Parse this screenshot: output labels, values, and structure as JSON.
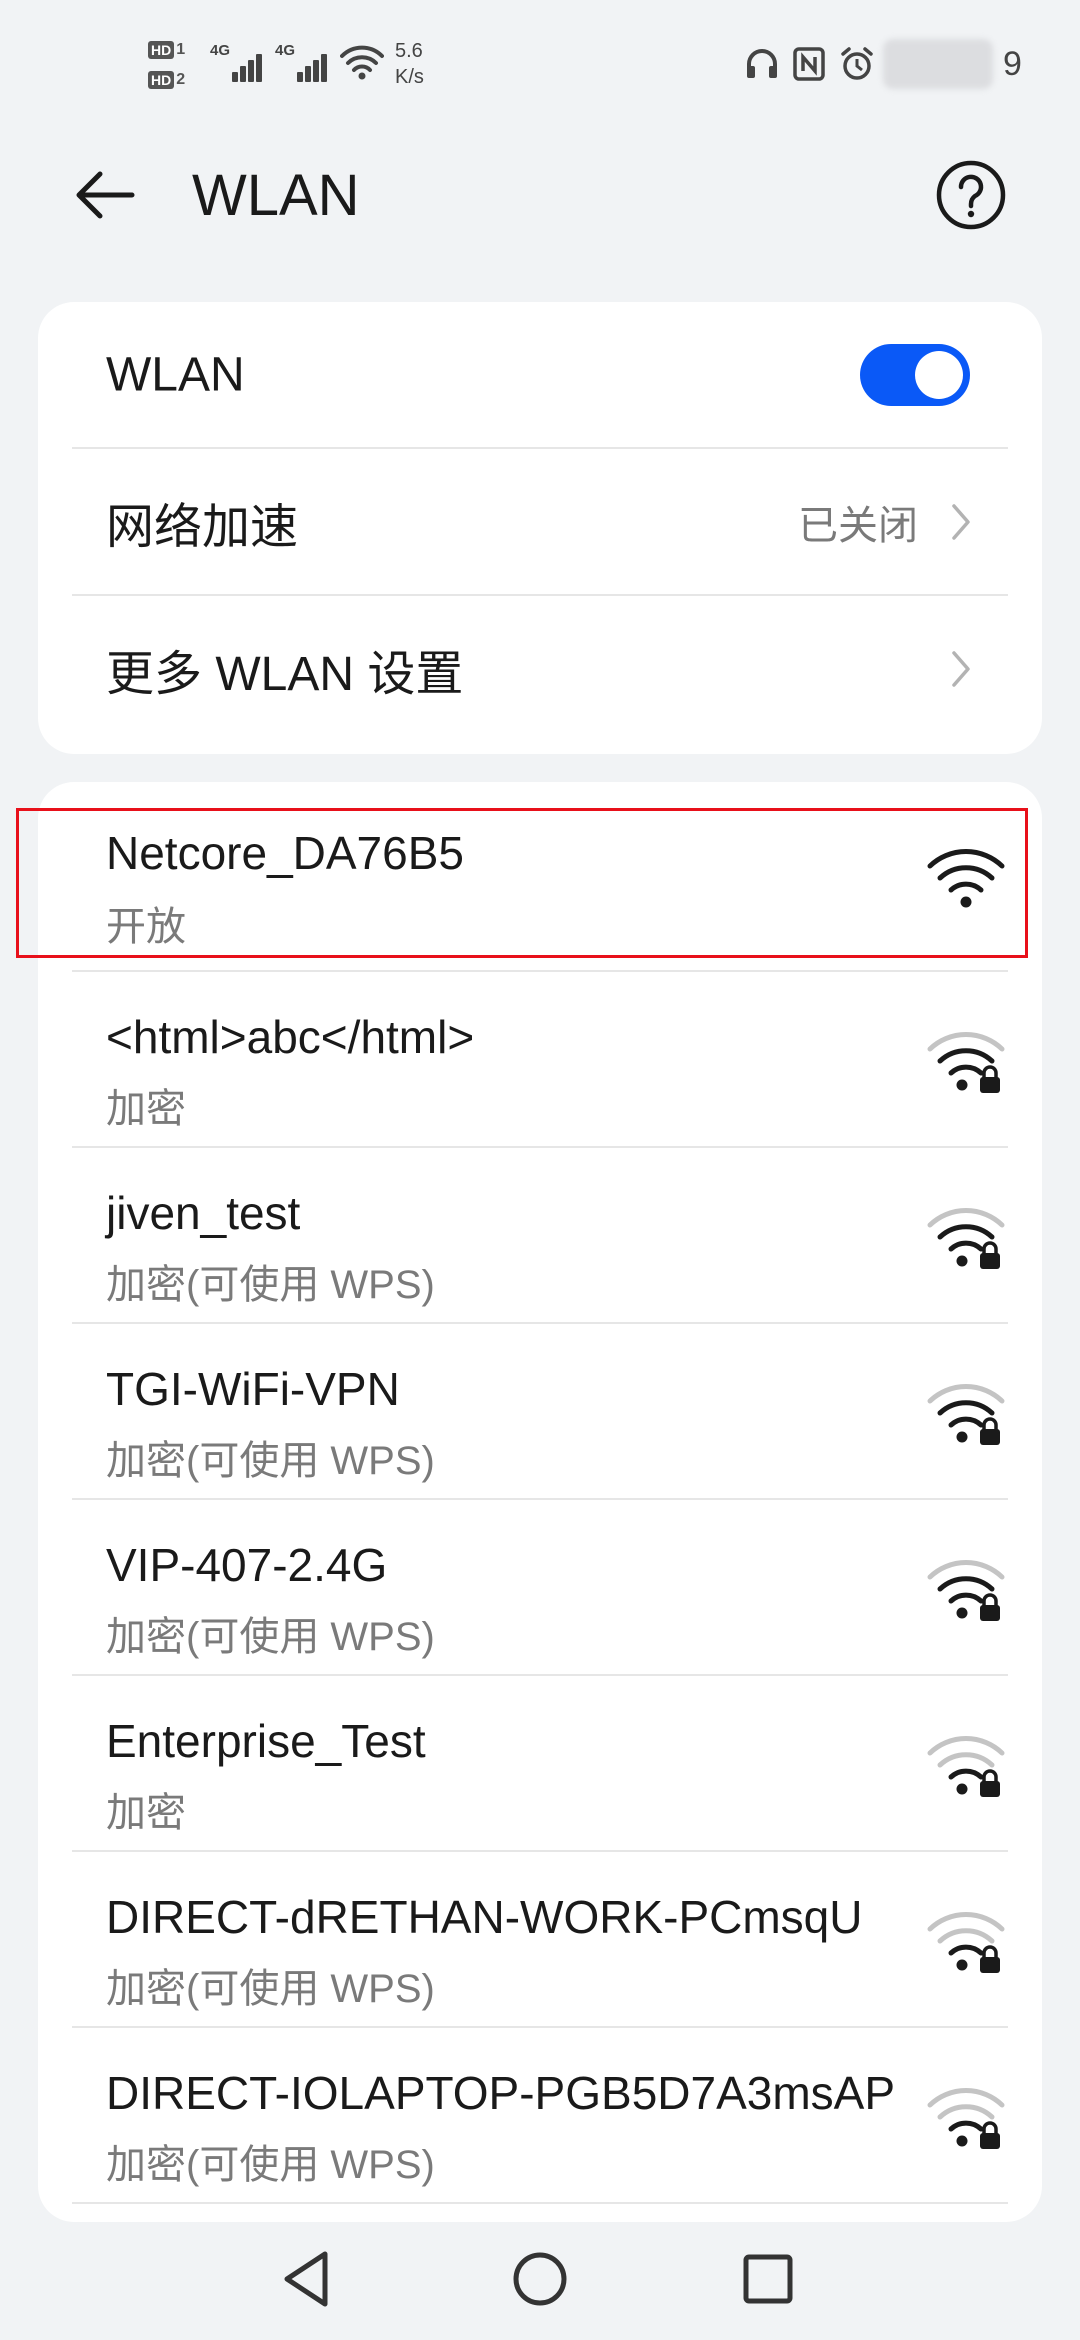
{
  "status_bar": {
    "hd1_label": "HD",
    "hd1_num": "1",
    "hd2_label": "HD",
    "hd2_num": "2",
    "sim1_label": "4G",
    "sim2_label": "4G",
    "speed_value": "5.6",
    "speed_unit": "K/s",
    "time_fragment": "9",
    "icons": [
      "headphones-icon",
      "nfc-icon",
      "alarm-icon",
      "battery-icon"
    ]
  },
  "header": {
    "title": "WLAN",
    "back_icon": "arrow-left-icon",
    "help_icon": "help-circle-icon"
  },
  "settings": {
    "wlan_label": "WLAN",
    "wlan_enabled": true,
    "accel_label": "网络加速",
    "accel_value": "已关闭",
    "more_label": "更多 WLAN 设置"
  },
  "networks": [
    {
      "name": "Netcore_DA76B5",
      "status": "开放",
      "secured": false,
      "signal": "full"
    },
    {
      "name": "<html>abc</html>",
      "status": "加密",
      "secured": true,
      "signal": "medium"
    },
    {
      "name": "jiven_test",
      "status": "加密(可使用 WPS)",
      "secured": true,
      "signal": "medium"
    },
    {
      "name": "TGI-WiFi-VPN",
      "status": "加密(可使用 WPS)",
      "secured": true,
      "signal": "medium"
    },
    {
      "name": "VIP-407-2.4G",
      "status": "加密(可使用 WPS)",
      "secured": true,
      "signal": "medium"
    },
    {
      "name": "Enterprise_Test",
      "status": "加密",
      "secured": true,
      "signal": "weak"
    },
    {
      "name": "DIRECT-dRETHAN-WORK-PCmsqU",
      "status": "加密(可使用 WPS)",
      "secured": true,
      "signal": "weak"
    },
    {
      "name": "DIRECT-IOLAPTOP-PGB5D7A3msAP",
      "status": "加密(可使用 WPS)",
      "secured": true,
      "signal": "weak"
    }
  ],
  "colors": {
    "accent": "#0a59f7",
    "highlight": "#e8101a",
    "background": "#f1f3f5"
  },
  "nav": {
    "back_icon": "triangle-back-icon",
    "home_icon": "circle-home-icon",
    "recents_icon": "square-recents-icon"
  }
}
